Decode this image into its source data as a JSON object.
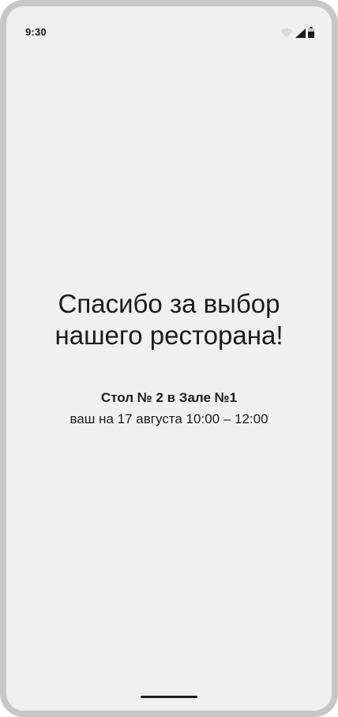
{
  "status_bar": {
    "time": "9:30",
    "icons": [
      "wifi-icon",
      "cellular-signal-icon",
      "battery-icon"
    ]
  },
  "confirmation": {
    "title_line1": "Спасибо за выбор",
    "title_line2": "нашего ресторана!",
    "table_info": "Стол № 2 в Зале №1",
    "reservation_time": "ваш на 17 августа 10:00 – 12:00"
  },
  "colors": {
    "background": "#f0f0f0",
    "frame": "#c7c7c7",
    "text": "#1c1c1c"
  }
}
